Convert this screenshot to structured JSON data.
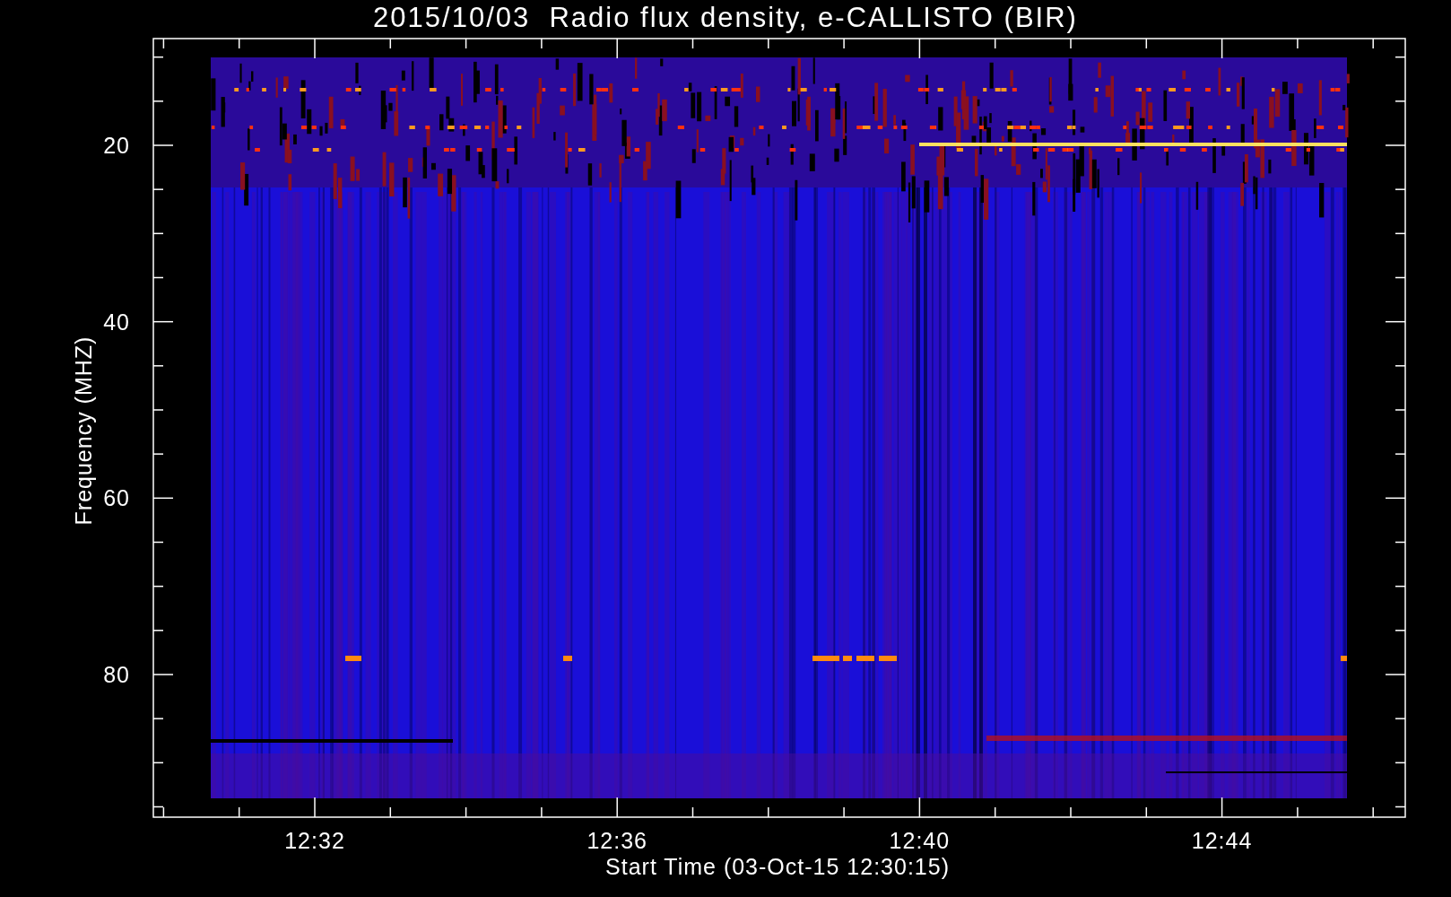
{
  "title": "2015/10/03  Radio flux density, e-CALLISTO (BIR)",
  "ylabel": "Frequency (MHZ)",
  "xlabel": "Start Time (03-Oct-15 12:30:15)",
  "y_ticks": [
    "20",
    "40",
    "60",
    "80"
  ],
  "x_ticks": [
    "12:32",
    "12:36",
    "12:40",
    "12:44"
  ]
}
